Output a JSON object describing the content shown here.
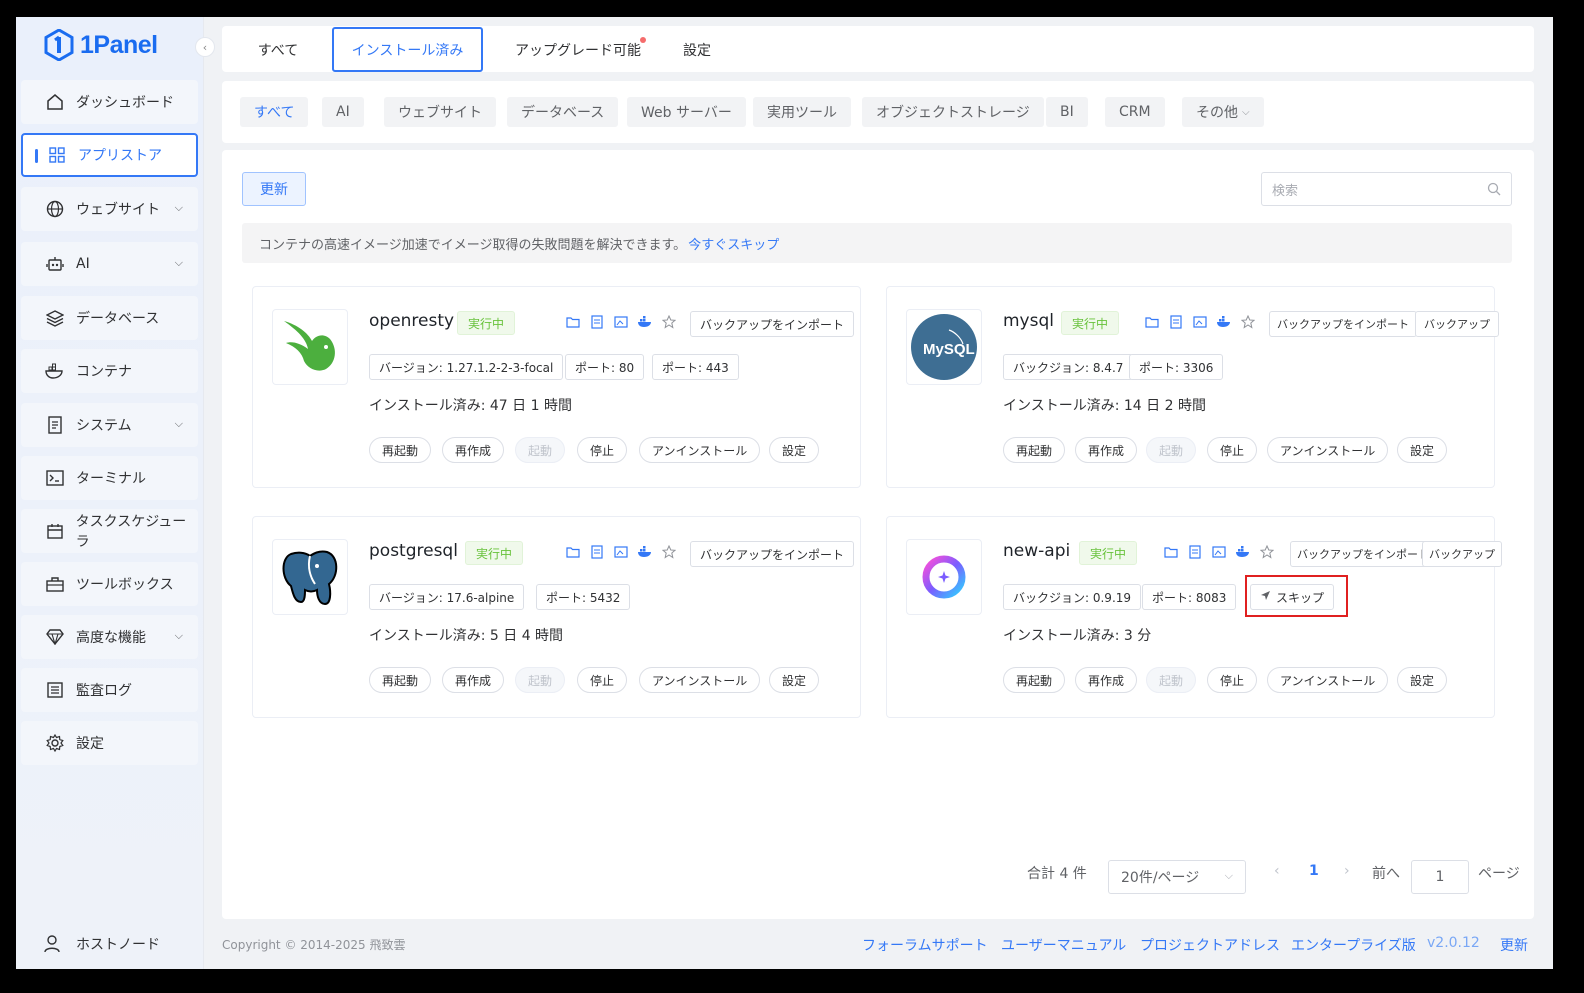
{
  "brand": {
    "name": "1Panel",
    "accent": "#3478f6"
  },
  "sidebar": {
    "items": [
      {
        "label": "ダッシュボード",
        "icon": "home-icon",
        "expandable": false
      },
      {
        "label": "アプリストア",
        "icon": "grid-icon",
        "expandable": false,
        "active": true
      },
      {
        "label": "ウェブサイト",
        "icon": "globe-icon",
        "expandable": true
      },
      {
        "label": "AI",
        "icon": "robot-icon",
        "expandable": true
      },
      {
        "label": "データベース",
        "icon": "layers-icon",
        "expandable": false
      },
      {
        "label": "コンテナ",
        "icon": "docker-icon",
        "expandable": false
      },
      {
        "label": "システム",
        "icon": "document-icon",
        "expandable": true
      },
      {
        "label": "ターミナル",
        "icon": "terminal-icon",
        "expandable": false
      },
      {
        "label": "タスクスケジューラ",
        "icon": "calendar-icon",
        "expandable": false
      },
      {
        "label": "ツールボックス",
        "icon": "toolbox-icon",
        "expandable": false
      },
      {
        "label": "高度な機能",
        "icon": "diamond-icon",
        "expandable": true
      },
      {
        "label": "監査ログ",
        "icon": "list-icon",
        "expandable": false
      },
      {
        "label": "設定",
        "icon": "gear-icon",
        "expandable": false
      }
    ],
    "host_node": "ホストノード"
  },
  "top_tabs": [
    "すべて",
    "インストール済み",
    "アップグレード可能",
    "設定"
  ],
  "categories": [
    "すべて",
    "AI",
    "ウェブサイト",
    "データベース",
    "Web サーバー",
    "実用ツール",
    "オブジェクトストレージ",
    "BI",
    "CRM",
    "その他"
  ],
  "toolbar": {
    "refresh_label": "更新",
    "search_placeholder": "検索"
  },
  "notice": {
    "text": "コンテナの高速イメージ加速でイメージ取得の失敗問題を解決できます。",
    "link": "今すぐスキップ"
  },
  "apps": [
    {
      "name": "openresty",
      "status": "実行中",
      "backup_import": "バックアップをインポート",
      "pills": [
        "バージョン: 1.27.1.2-2-3-focal",
        "ポート: 80",
        "ポート: 443"
      ],
      "installed": "インストール済み: 47 日 1 時間"
    },
    {
      "name": "mysql",
      "status": "実行中",
      "backup_import": "バックアップをインポート",
      "backup": "バックアップ",
      "pills": [
        "バックジョン: 8.4.7",
        "ポート: 3306"
      ],
      "installed": "インストール済み: 14 日 2 時間"
    },
    {
      "name": "postgresql",
      "status": "実行中",
      "backup_import": "バックアップをインポート",
      "pills": [
        "バージョン: 17.6-alpine",
        "ポート: 5432"
      ],
      "installed": "インストール済み: 5 日 4 時間"
    },
    {
      "name": "new-api",
      "status": "実行中",
      "backup_import": "バックアップをインポート",
      "backup": "バックアップ",
      "pills": [
        "バックジョン: 0.9.19",
        "ポート: 8083"
      ],
      "skip": "スキップ",
      "installed": "インストール済み: 3 分"
    }
  ],
  "actions": [
    "再起動",
    "再作成",
    "起動",
    "停止",
    "アンインストール",
    "設定"
  ],
  "logo_text": {
    "mysql": "MySQL"
  },
  "pagination": {
    "total": "合計 4 件",
    "per_page": "20件/ページ",
    "current": "1",
    "goto_prefix": "前へ",
    "goto_value": "1",
    "goto_suffix": "ページ"
  },
  "footer": {
    "copyright": "Copyright © 2014-2025 飛致雲",
    "links": [
      "フォーラムサポート",
      "ユーザーマニュアル",
      "プロジェクトアドレス",
      "エンタープライズ版",
      "v2.0.12",
      "更新"
    ]
  }
}
